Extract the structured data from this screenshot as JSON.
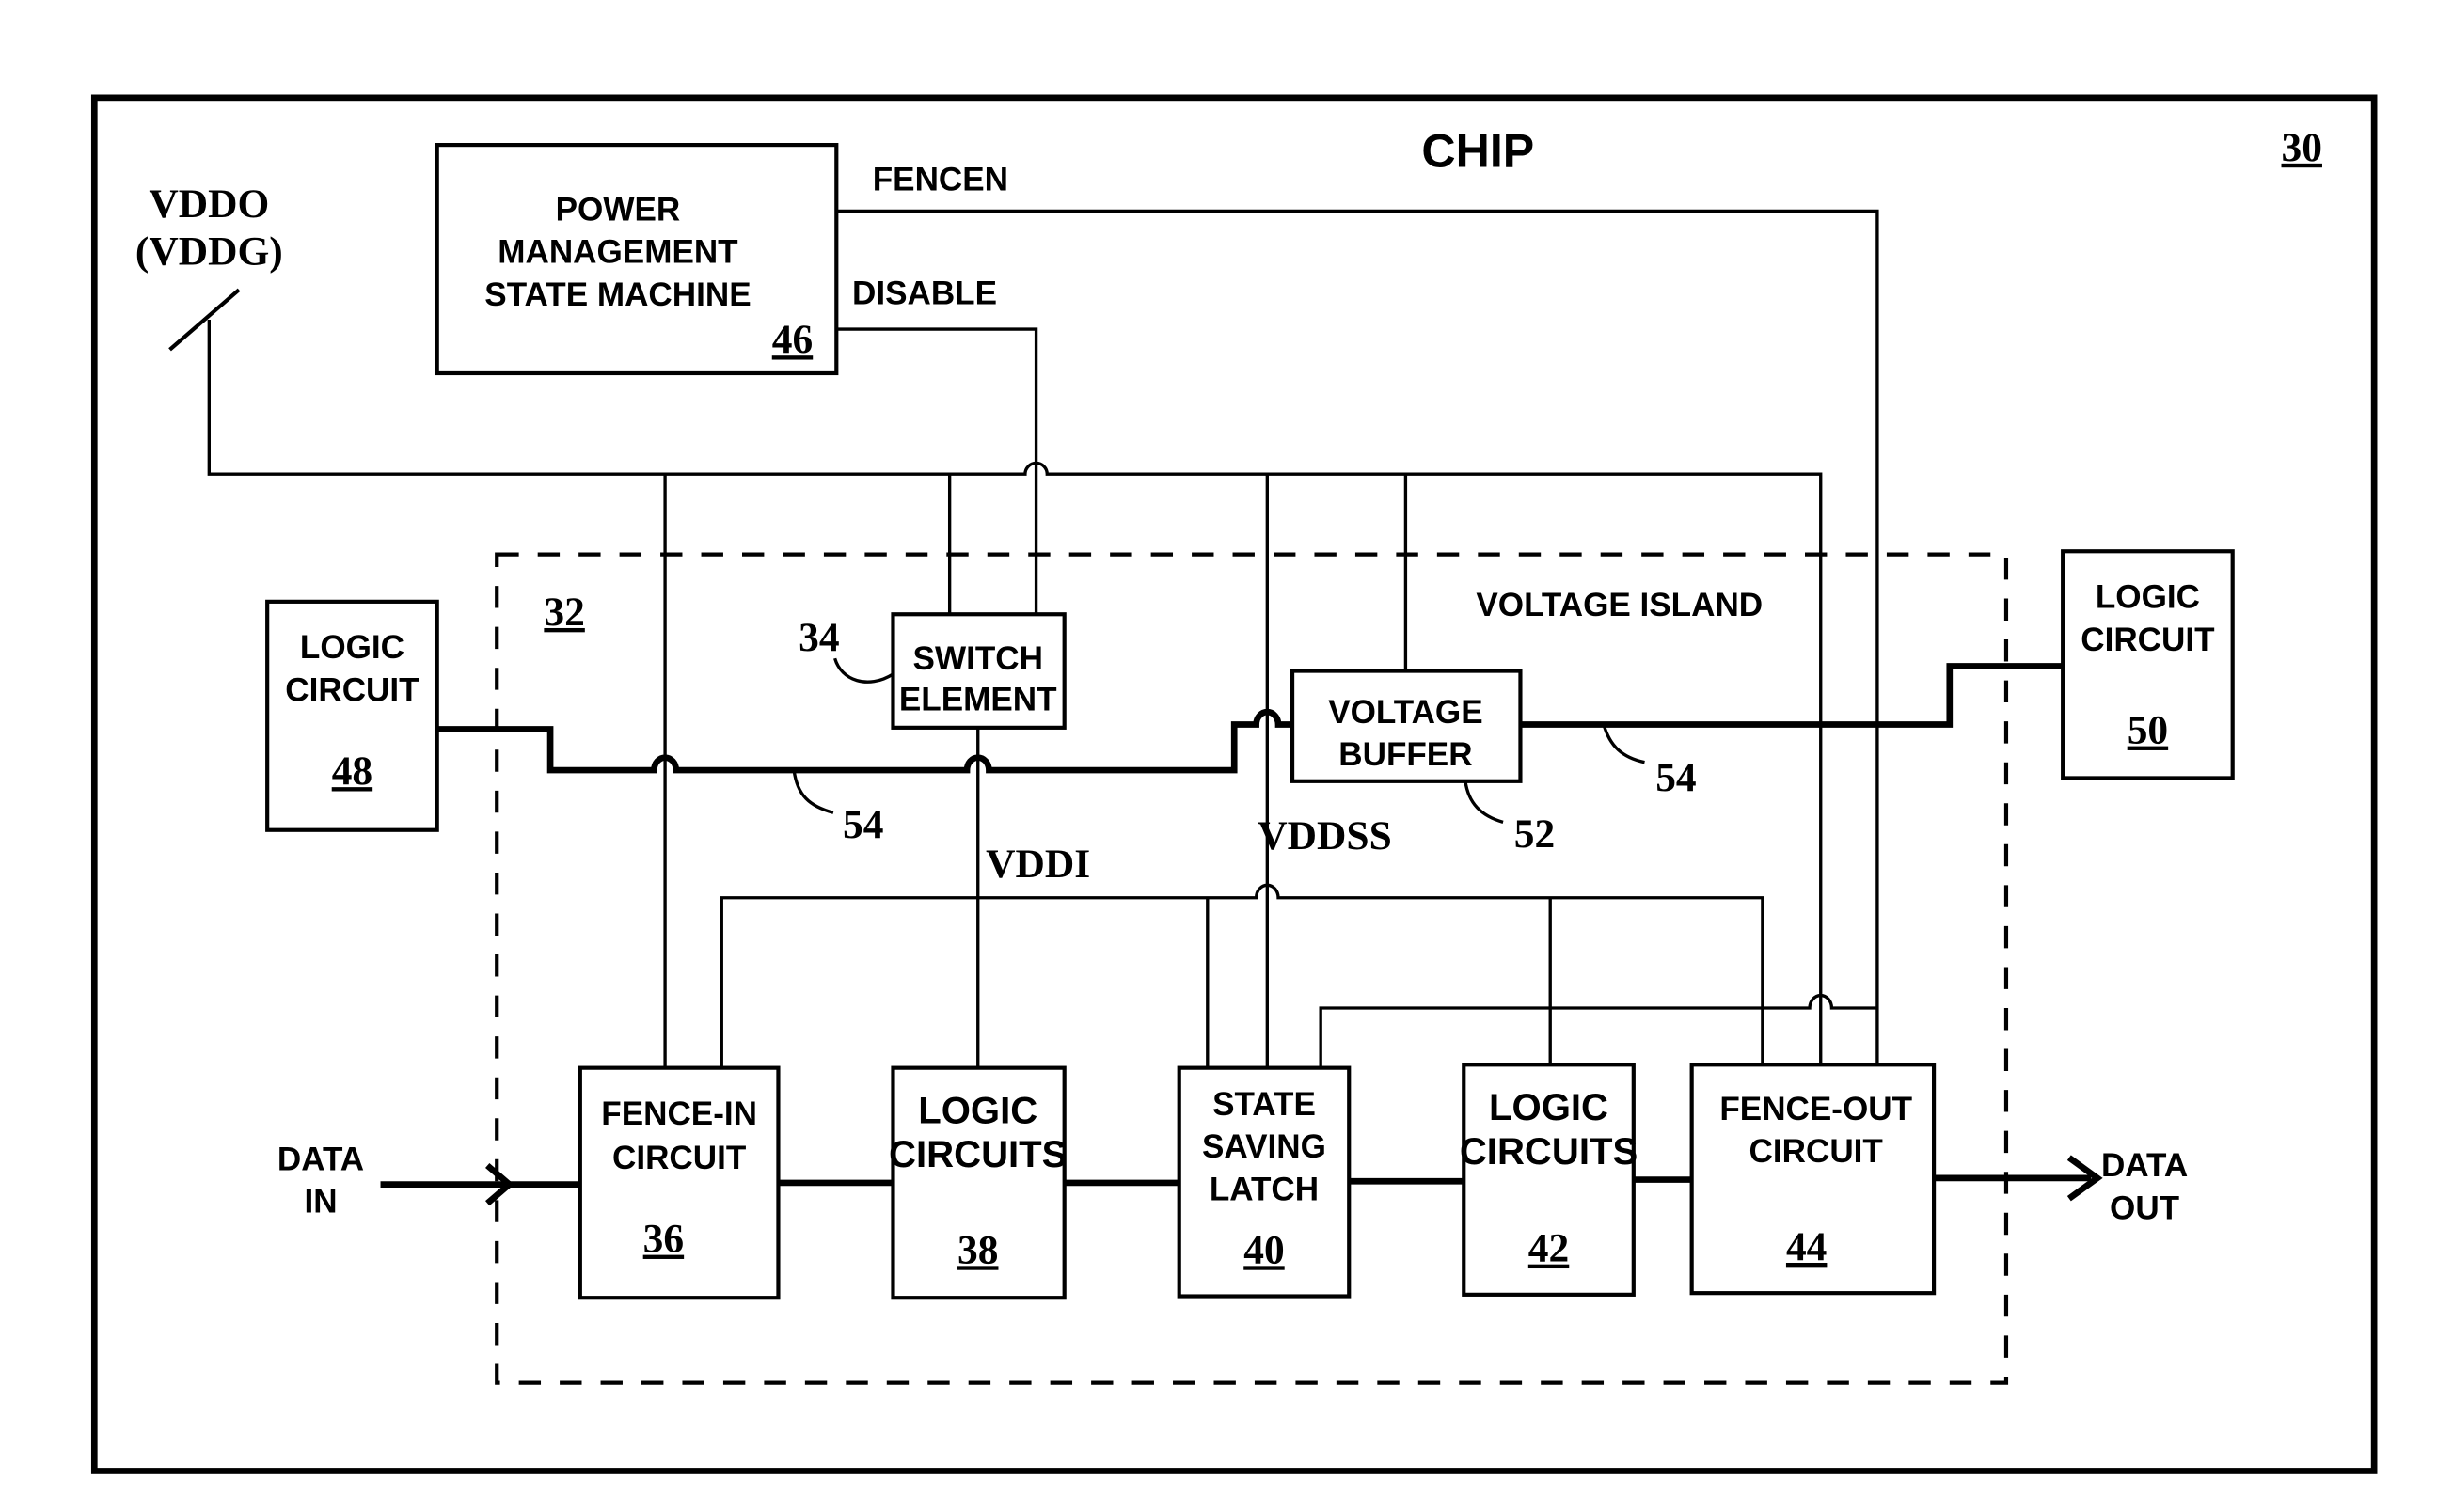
{
  "diagram": {
    "chip": {
      "title": "CHIP",
      "ref": "30"
    },
    "supply_label_line1": "VDDO",
    "supply_label_line2": "(VDDG)",
    "power_mgmt": {
      "line1": "POWER",
      "line2": "MANAGEMENT",
      "line3": "STATE MACHINE",
      "ref": "46"
    },
    "signals": {
      "fencen": "FENCEN",
      "disable": "DISABLE",
      "vddi": "VDDI",
      "vddss": "VDDSS"
    },
    "voltage_island": {
      "label": "VOLTAGE ISLAND",
      "ref": "32"
    },
    "switch_element": {
      "line1": "SWITCH",
      "line2": "ELEMENT",
      "ref": "34"
    },
    "voltage_buffer": {
      "line1": "VOLTAGE",
      "line2": "BUFFER",
      "ref": "52"
    },
    "logic_left": {
      "line1": "LOGIC",
      "line2": "CIRCUIT",
      "ref": "48"
    },
    "logic_right": {
      "line1": "LOGIC",
      "line2": "CIRCUIT",
      "ref": "50"
    },
    "bus_ref": "54",
    "fence_in": {
      "line1": "FENCE-IN",
      "line2": "CIRCUIT",
      "ref": "36"
    },
    "logic_38": {
      "line1": "LOGIC",
      "line2": "CIRCUITS",
      "ref": "38"
    },
    "latch": {
      "line1": "STATE",
      "line2": "SAVING",
      "line3": "LATCH",
      "ref": "40"
    },
    "logic_42": {
      "line1": "LOGIC",
      "line2": "CIRCUITS",
      "ref": "42"
    },
    "fence_out": {
      "line1": "FENCE-OUT",
      "line2": "CIRCUIT",
      "ref": "44"
    },
    "data_in": {
      "line1": "DATA",
      "line2": "IN"
    },
    "data_out": {
      "line1": "DATA",
      "line2": "OUT"
    }
  }
}
